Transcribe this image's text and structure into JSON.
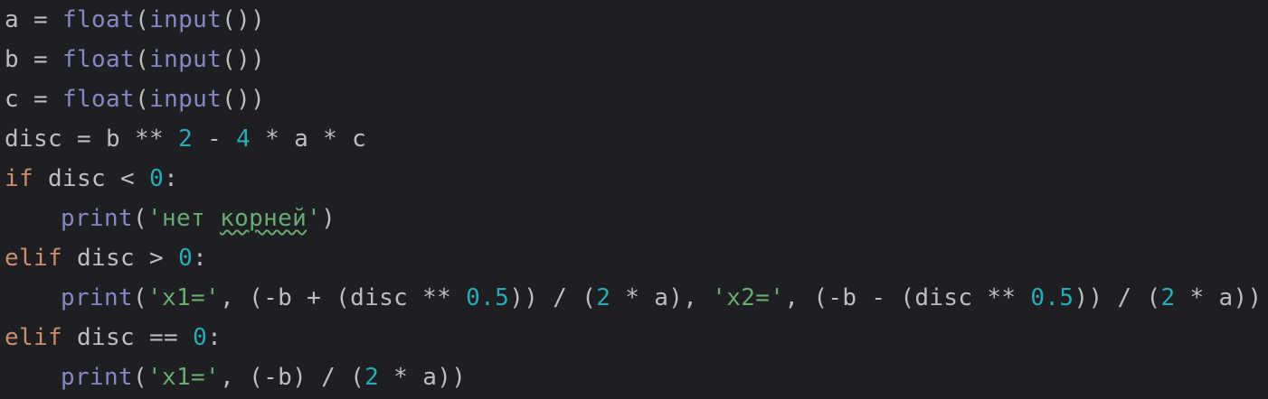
{
  "editor": {
    "language": "python",
    "theme": {
      "background": "#1e1f22",
      "default_text": "#bcbec4",
      "builtin": "#8888c6",
      "number": "#2aacb8",
      "keyword": "#cf8e6d",
      "string": "#6aab73"
    },
    "lines": [
      {
        "tokens": [
          {
            "t": "id",
            "v": "a"
          },
          {
            "t": "op",
            "v": " = "
          },
          {
            "t": "builtin",
            "v": "float"
          },
          {
            "t": "punc",
            "v": "("
          },
          {
            "t": "builtin",
            "v": "input"
          },
          {
            "t": "punc",
            "v": "())"
          }
        ]
      },
      {
        "tokens": [
          {
            "t": "id",
            "v": "b"
          },
          {
            "t": "op",
            "v": " = "
          },
          {
            "t": "builtin",
            "v": "float"
          },
          {
            "t": "punc",
            "v": "("
          },
          {
            "t": "builtin",
            "v": "input"
          },
          {
            "t": "punc",
            "v": "())"
          }
        ]
      },
      {
        "tokens": [
          {
            "t": "id",
            "v": "c"
          },
          {
            "t": "op",
            "v": " = "
          },
          {
            "t": "builtin",
            "v": "float"
          },
          {
            "t": "punc",
            "v": "("
          },
          {
            "t": "builtin",
            "v": "input"
          },
          {
            "t": "punc",
            "v": "())"
          }
        ]
      },
      {
        "tokens": [
          {
            "t": "id",
            "v": "disc"
          },
          {
            "t": "op",
            "v": " = "
          },
          {
            "t": "id",
            "v": "b"
          },
          {
            "t": "op",
            "v": " ** "
          },
          {
            "t": "num",
            "v": "2"
          },
          {
            "t": "op",
            "v": " - "
          },
          {
            "t": "num",
            "v": "4"
          },
          {
            "t": "op",
            "v": " * "
          },
          {
            "t": "id",
            "v": "a"
          },
          {
            "t": "op",
            "v": " * "
          },
          {
            "t": "id",
            "v": "c"
          }
        ]
      },
      {
        "tokens": [
          {
            "t": "kw",
            "v": "if"
          },
          {
            "t": "id",
            "v": " disc"
          },
          {
            "t": "op",
            "v": " < "
          },
          {
            "t": "num",
            "v": "0"
          },
          {
            "t": "punc",
            "v": ":"
          }
        ]
      },
      {
        "indent": true,
        "tokens": [
          {
            "t": "builtin",
            "v": "print"
          },
          {
            "t": "punc",
            "v": "("
          },
          {
            "t": "str",
            "v": "'нет "
          },
          {
            "t": "str",
            "v": "корней",
            "typo": true
          },
          {
            "t": "str",
            "v": "'"
          },
          {
            "t": "punc",
            "v": ")"
          }
        ]
      },
      {
        "tokens": [
          {
            "t": "kw",
            "v": "elif"
          },
          {
            "t": "id",
            "v": " disc"
          },
          {
            "t": "op",
            "v": " > "
          },
          {
            "t": "num",
            "v": "0"
          },
          {
            "t": "punc",
            "v": ":"
          }
        ]
      },
      {
        "indent": true,
        "tokens": [
          {
            "t": "builtin",
            "v": "print"
          },
          {
            "t": "punc",
            "v": "("
          },
          {
            "t": "str",
            "v": "'x1='"
          },
          {
            "t": "punc",
            "v": ", (-"
          },
          {
            "t": "id",
            "v": "b"
          },
          {
            "t": "op",
            "v": " + "
          },
          {
            "t": "punc",
            "v": "("
          },
          {
            "t": "id",
            "v": "disc"
          },
          {
            "t": "op",
            "v": " ** "
          },
          {
            "t": "num",
            "v": "0.5"
          },
          {
            "t": "punc",
            "v": "))"
          },
          {
            "t": "op",
            "v": " / "
          },
          {
            "t": "punc",
            "v": "("
          },
          {
            "t": "num",
            "v": "2"
          },
          {
            "t": "op",
            "v": " * "
          },
          {
            "t": "id",
            "v": "a"
          },
          {
            "t": "punc",
            "v": "), "
          },
          {
            "t": "str",
            "v": "'x2='"
          },
          {
            "t": "punc",
            "v": ", (-"
          },
          {
            "t": "id",
            "v": "b"
          },
          {
            "t": "op",
            "v": " - "
          },
          {
            "t": "punc",
            "v": "("
          },
          {
            "t": "id",
            "v": "disc"
          },
          {
            "t": "op",
            "v": " ** "
          },
          {
            "t": "num",
            "v": "0.5"
          },
          {
            "t": "punc",
            "v": "))"
          },
          {
            "t": "op",
            "v": " / "
          },
          {
            "t": "punc",
            "v": "("
          },
          {
            "t": "num",
            "v": "2"
          },
          {
            "t": "op",
            "v": " * "
          },
          {
            "t": "id",
            "v": "a"
          },
          {
            "t": "punc",
            "v": "))"
          }
        ]
      },
      {
        "tokens": [
          {
            "t": "kw",
            "v": "elif"
          },
          {
            "t": "id",
            "v": " disc"
          },
          {
            "t": "op",
            "v": " == "
          },
          {
            "t": "num",
            "v": "0"
          },
          {
            "t": "punc",
            "v": ":"
          }
        ]
      },
      {
        "indent": true,
        "tokens": [
          {
            "t": "builtin",
            "v": "print"
          },
          {
            "t": "punc",
            "v": "("
          },
          {
            "t": "str",
            "v": "'x1='"
          },
          {
            "t": "punc",
            "v": ", (-"
          },
          {
            "t": "id",
            "v": "b"
          },
          {
            "t": "punc",
            "v": ")"
          },
          {
            "t": "op",
            "v": " / "
          },
          {
            "t": "punc",
            "v": "("
          },
          {
            "t": "num",
            "v": "2"
          },
          {
            "t": "op",
            "v": " * "
          },
          {
            "t": "id",
            "v": "a"
          },
          {
            "t": "punc",
            "v": "))"
          }
        ]
      }
    ]
  }
}
